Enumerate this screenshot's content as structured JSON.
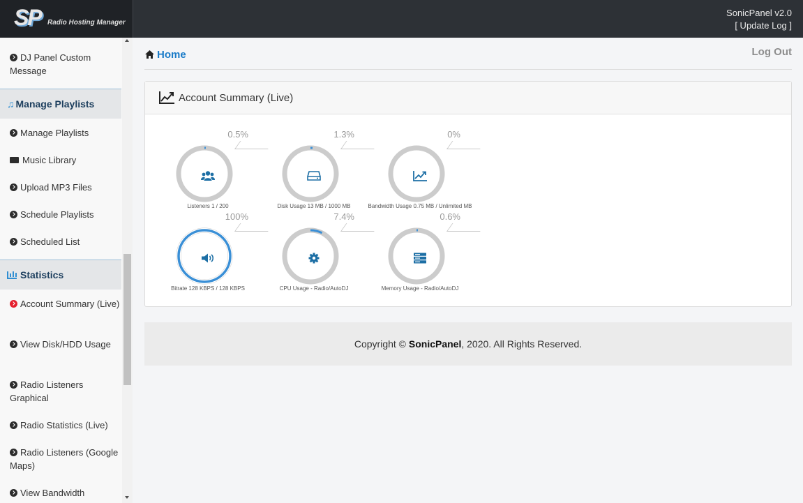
{
  "header": {
    "logo_text": "SP",
    "logo_subtitle": "Radio Hosting Manager",
    "version": "SonicPanel v2.0",
    "update_log": "[ Update Log ]"
  },
  "sidebar": {
    "items_top": [
      {
        "label": "DJ Panel Custom Message"
      }
    ],
    "section_playlists": "Manage Playlists",
    "playlist_items": [
      {
        "label": "Manage Playlists"
      },
      {
        "label": "Music Library"
      },
      {
        "label": "Upload MP3 Files"
      },
      {
        "label": "Schedule Playlists"
      },
      {
        "label": "Scheduled List"
      }
    ],
    "section_statistics": "Statistics",
    "stat_items": [
      {
        "label": "Account Summary (Live)"
      },
      {
        "label": "View Disk/HDD Usage"
      },
      {
        "label": "Radio Listeners Graphical"
      },
      {
        "label": "Radio Statistics (Live)"
      },
      {
        "label": "Radio Listeners (Google Maps)"
      },
      {
        "label": "View Bandwidth"
      }
    ]
  },
  "breadcrumb": {
    "home": "Home"
  },
  "logout": "Log Out",
  "panel": {
    "title": "Account Summary (Live)",
    "gauges": [
      {
        "pct": "0.5%",
        "value": 0.005,
        "label": "Listeners 1 / 200",
        "icon": "users-icon"
      },
      {
        "pct": "1.3%",
        "value": 0.013,
        "label": "Disk Usage 13 MB / 1000 MB",
        "icon": "hdd-icon"
      },
      {
        "pct": "0%",
        "value": 0,
        "label": "Bandwidth Usage 0.75 MB / Unlimited MB",
        "icon": "line-chart-icon"
      },
      {
        "pct": "100%",
        "value": 1.0,
        "label": "Bitrate 128 KBPS / 128 KBPS",
        "icon": "volume-icon"
      },
      {
        "pct": "7.4%",
        "value": 0.074,
        "label": "CPU Usage - Radio/AutoDJ",
        "icon": "gear-icon"
      },
      {
        "pct": "0.6%",
        "value": 0.006,
        "label": "Memory Usage - Radio/AutoDJ",
        "icon": "server-icon"
      }
    ]
  },
  "footer": {
    "prefix": "Copyright © ",
    "brand": "SonicPanel",
    "suffix": ", 2020. All Rights Reserved."
  },
  "colors": {
    "accent": "#1a7bc8",
    "ring_track": "#cccccc",
    "ring_fill": "#3a8fd6",
    "icon": "#1d6fa5"
  }
}
